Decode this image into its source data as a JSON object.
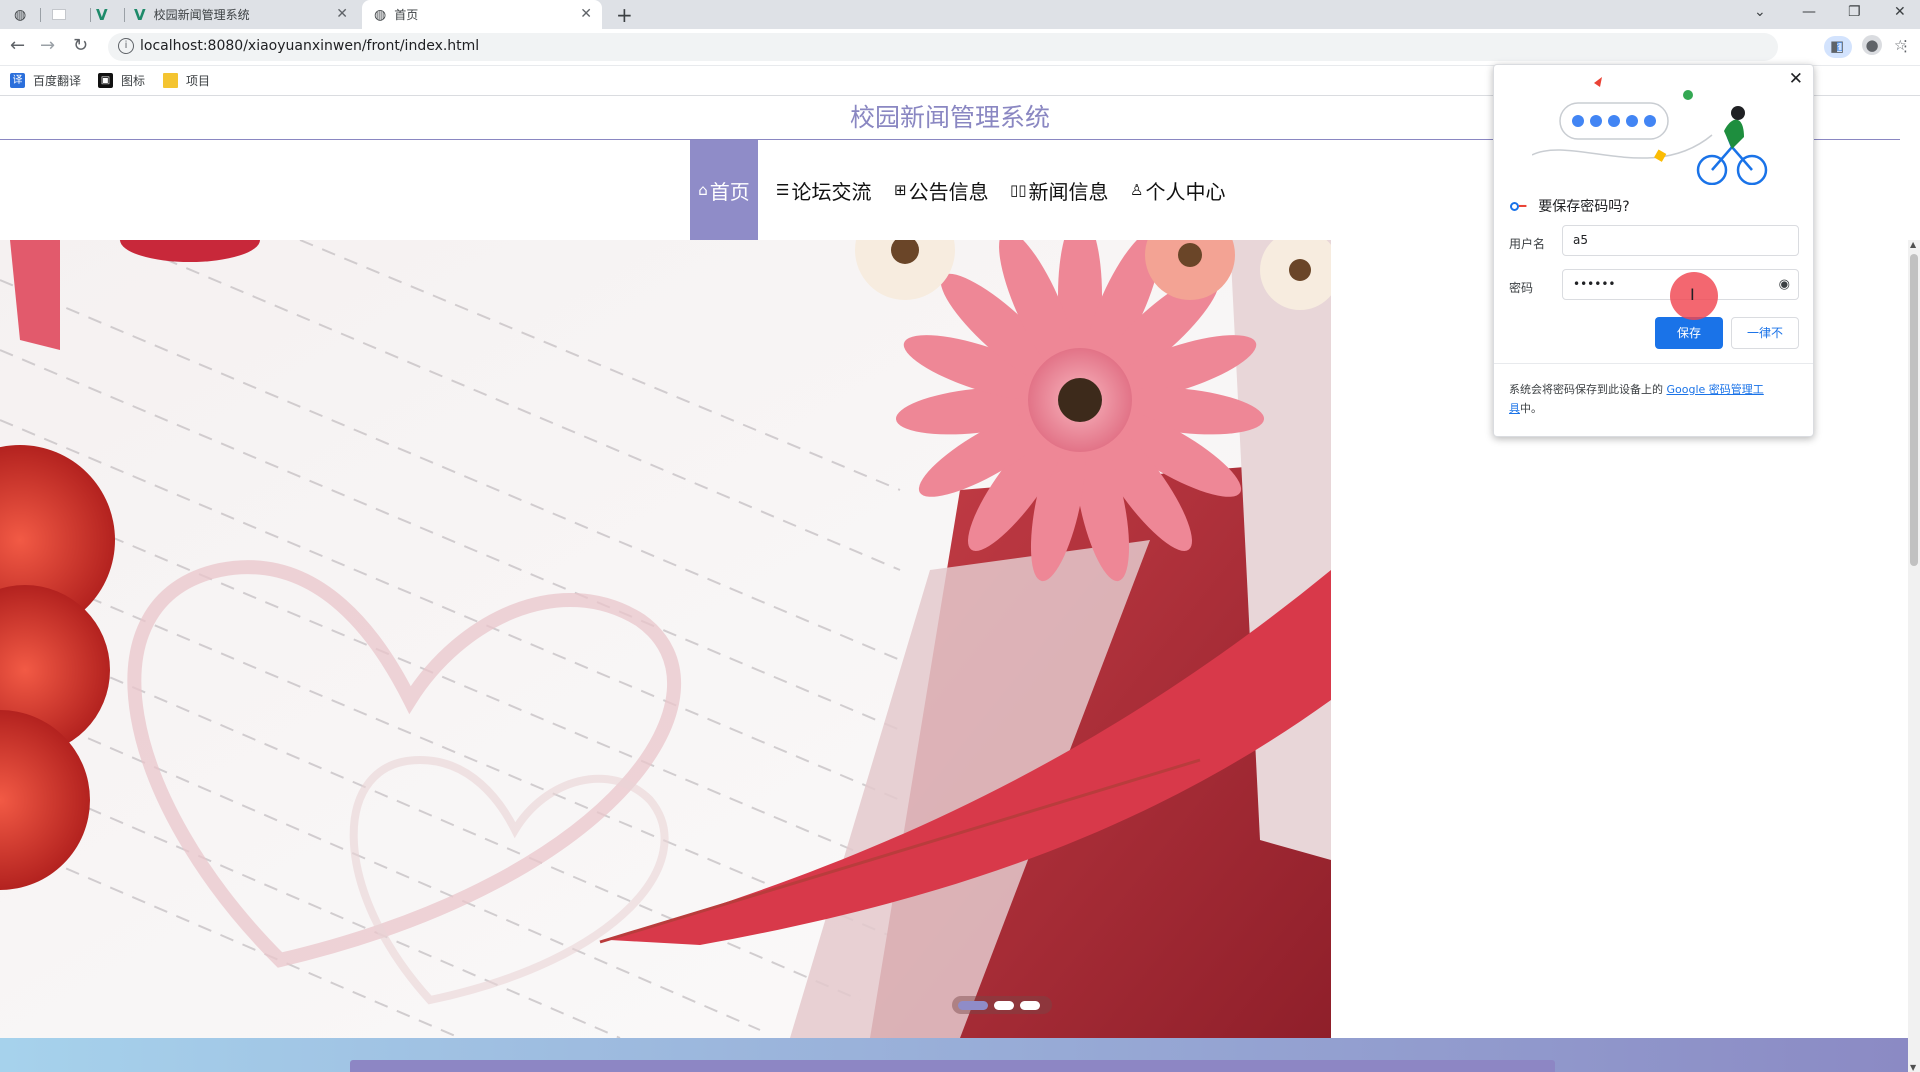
{
  "browser": {
    "tabs": [
      {
        "title": "",
        "icon": "globe-icon"
      },
      {
        "title": "",
        "icon": "blank-page-icon"
      },
      {
        "title": "",
        "icon": "vue-logo-icon"
      },
      {
        "title": "校园新闻管理系统",
        "icon": "vue-logo-icon"
      },
      {
        "title": "首页",
        "icon": "globe-icon"
      }
    ],
    "new_tab": "+",
    "url": "localhost:8080/xiaoyuanxinwen/front/index.html",
    "bookmarks": [
      {
        "label": "百度翻译",
        "icon": "translate-icon"
      },
      {
        "label": "图标",
        "icon": "image-icon"
      },
      {
        "label": "项目",
        "icon": "folder-icon"
      }
    ]
  },
  "site": {
    "title": "校园新闻管理系统",
    "menu": [
      {
        "label": "首页",
        "glyph": "⌂",
        "active": true
      },
      {
        "label": "论坛交流",
        "glyph": "☰",
        "active": false
      },
      {
        "label": "公告信息",
        "glyph": "⊞",
        "active": false
      },
      {
        "label": "新闻信息",
        "glyph": "▯▯",
        "active": false
      },
      {
        "label": "个人中心",
        "glyph": "♙",
        "active": false
      }
    ],
    "carousel": {
      "slides": 3,
      "active": 0
    }
  },
  "password_popup": {
    "title": "要保存密码吗?",
    "username_label": "用户名",
    "username_value": "a5",
    "password_label": "密码",
    "password_value": "••••••",
    "save_label": "保存",
    "never_label": "一律不",
    "footer_text": "系统会将密码保存到此设备上的 ",
    "footer_link_part1": "Google 密码管理工",
    "footer_link_part2": "具",
    "footer_end": "中。"
  },
  "colors": {
    "accent": "#8f8cc8",
    "title": "#8a87c2",
    "chrome_blue": "#1a73e8"
  }
}
